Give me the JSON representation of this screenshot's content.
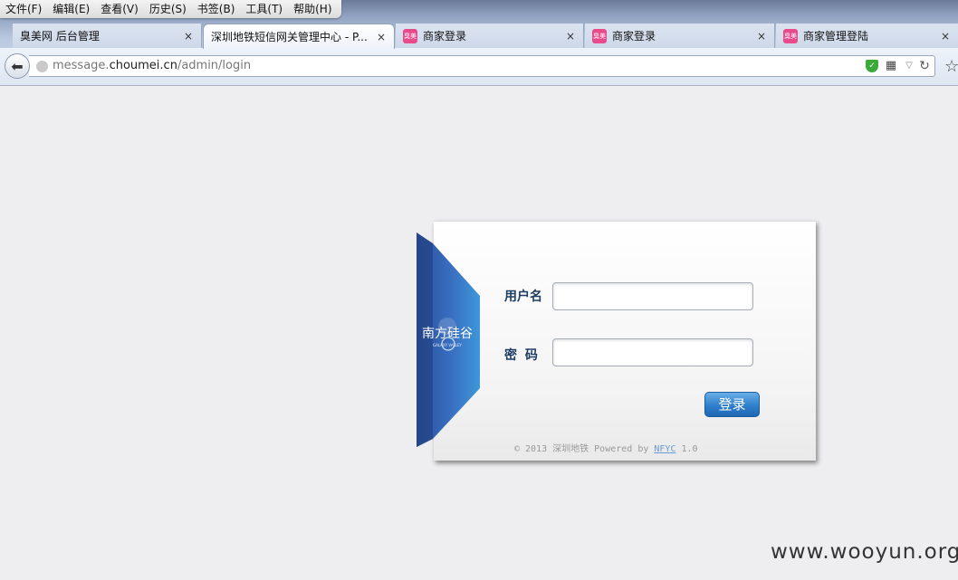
{
  "menu": [
    "文件(F)",
    "编辑(E)",
    "查看(V)",
    "历史(S)",
    "书签(B)",
    "工具(T)",
    "帮助(H)"
  ],
  "tabs": [
    {
      "title": "臭美网 后台管理",
      "favicon": ""
    },
    {
      "title": "深圳地铁短信网关管理中心 - P...",
      "favicon": ""
    },
    {
      "title": "商家登录",
      "favicon": "臭美"
    },
    {
      "title": "商家登录",
      "favicon": "臭美"
    },
    {
      "title": "商家管理登陆",
      "favicon": "臭美"
    }
  ],
  "tab_close_glyph": "×",
  "url": {
    "prefix": "message.",
    "domain": "choumei.cn",
    "path": "/admin/login"
  },
  "login": {
    "username_label": "用户名",
    "password_label": "密 码",
    "button": "登录",
    "logo_text": "南方硅谷",
    "logo_subtext": "GALAXY VALLEY",
    "footer": {
      "copyright": "© 2013 深圳地铁 Powered by ",
      "link": "NFYC",
      "version": " 1.0"
    }
  },
  "watermark": "www.wooyun.org",
  "colors": {
    "ribbon": "#3a6fc0",
    "button": "#2f7fcc",
    "label": "#1d3d63"
  }
}
